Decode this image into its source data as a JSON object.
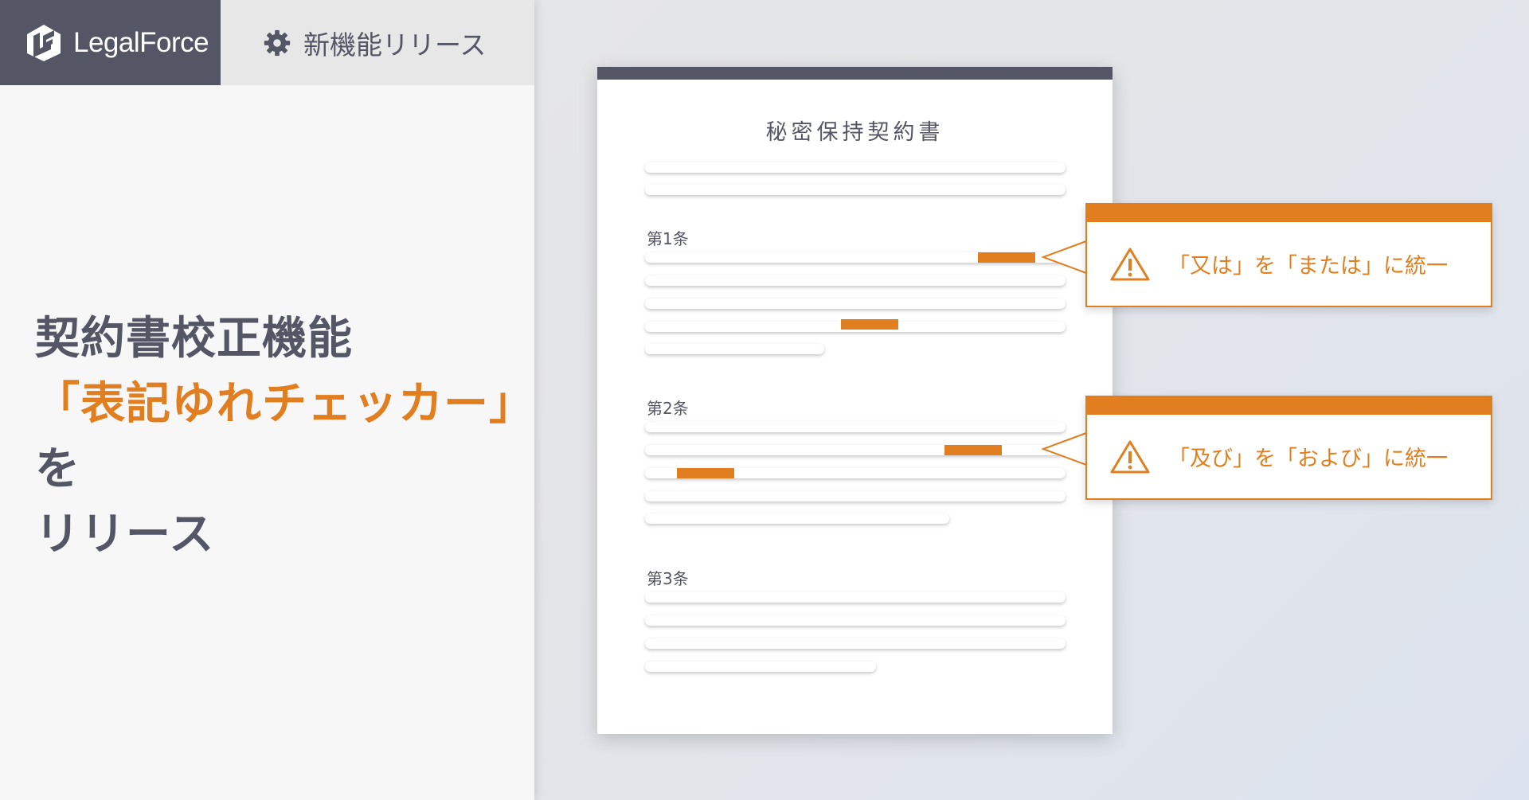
{
  "brand": {
    "name": "LegalForce"
  },
  "tag": {
    "label": "新機能リリース",
    "icon": "gear-icon"
  },
  "headline": {
    "line1": "契約書校正機能",
    "line2_accent": "「表記ゆれチェッカー」",
    "line2_rest": "を",
    "line3": "リリース"
  },
  "document": {
    "title": "秘密保持契約書",
    "articles": [
      "第1条",
      "第2条",
      "第3条"
    ]
  },
  "callouts": [
    {
      "text": "「又は」を「または」に統一",
      "icon": "warning-icon"
    },
    {
      "text": "「及び」を「および」に統一",
      "icon": "warning-icon"
    }
  ],
  "colors": {
    "accent": "#e17f20",
    "dark": "#545665"
  }
}
